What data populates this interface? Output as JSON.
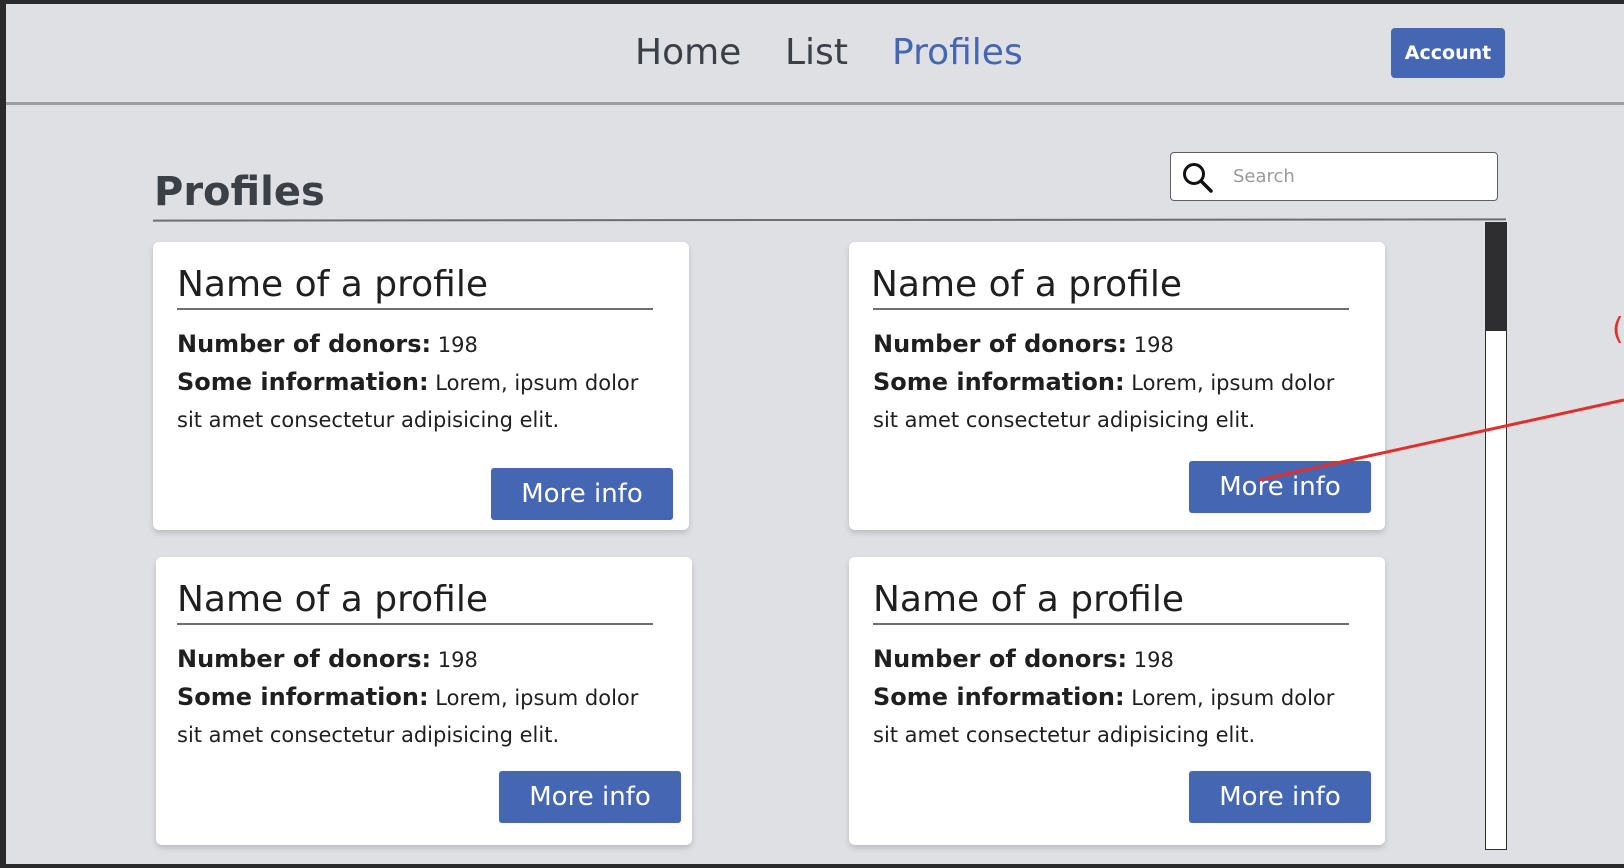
{
  "nav": {
    "items": [
      "Home",
      "List",
      "Profiles"
    ],
    "active": "Profiles",
    "account_label": "Account"
  },
  "page": {
    "title": "Profiles"
  },
  "search": {
    "placeholder": "Search"
  },
  "cards": [
    {
      "name": "Name of a profile",
      "donors_label": "Number of donors:",
      "donors_value": "198",
      "info_label": "Some information:",
      "info_text": "Lorem, ipsum dolor sit amet consectetur adipisicing elit.",
      "button_label": "More info"
    },
    {
      "name": "Name of a profile",
      "donors_label": "Number of donors:",
      "donors_value": "198",
      "info_label": "Some information:",
      "info_text": "Lorem, ipsum dolor sit amet consectetur adipisicing elit.",
      "button_label": "More info"
    },
    {
      "name": "Name of a profile",
      "donors_label": "Number of donors:",
      "donors_value": "198",
      "info_label": "Some information:",
      "info_text": "Lorem, ipsum dolor sit amet consectetur adipisicing elit.",
      "button_label": "More info"
    },
    {
      "name": "Name of a profile",
      "donors_label": "Number of donors:",
      "donors_value": "198",
      "info_label": "Some information:",
      "info_text": "Lorem, ipsum dolor sit amet consectetur adipisicing elit.",
      "button_label": "More info"
    }
  ],
  "annotation": {
    "mark": "("
  },
  "colors": {
    "accent": "#4466b3",
    "background": "#dfe0e4",
    "annotation": "#e0302e"
  },
  "icons": {
    "search": "search-icon"
  }
}
